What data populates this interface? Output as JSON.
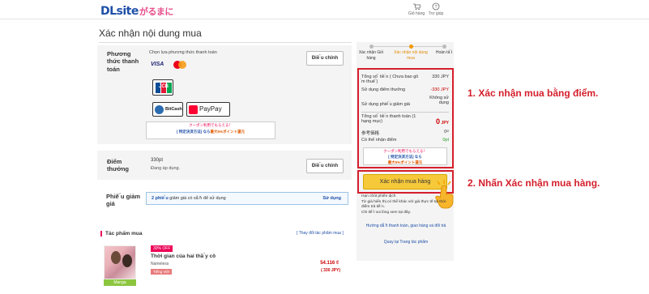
{
  "header": {
    "logo_main": "DLsite",
    "logo_sub": "がるまに",
    "cart_label": "Giỏ hàng",
    "help_label": "Trợ giúp"
  },
  "page_title": "Xác nhận nội dung mua",
  "payment": {
    "label": "Phương thức thanh toán",
    "hint": "Chọn lựa phương thức thanh toán",
    "change_label": "Điề ̀u chỉnh",
    "methods": [
      "VISA",
      "JCB",
      "BitCash",
      "PayPay"
    ],
    "coupon_line1": "クーポン利用でもらえる！",
    "coupon_line2": "[ 特定決済方法] なら",
    "coupon_line3": "最大5%ポイント還元"
  },
  "points": {
    "label": "Điểm thưởng",
    "value": "330pt",
    "status": "Đang áp dụng.",
    "change_label": "Điề ̀u chỉnh"
  },
  "discount": {
    "label": "Phiế ́u giảm giá",
    "text_prefix": "2 phiế ́u",
    "text_rest": " giảm giá có sẵ ̃n để sử dụng",
    "use_label": "Sử dụng"
  },
  "works": {
    "title": "Tác phẩm mua",
    "change_link": "[ Thay đổi tác phẩm mua ]",
    "items": [
      {
        "discount_badge": "30% OFF",
        "title": "Thời gian của hai thầ ̀y cô",
        "circle": "Nameless",
        "tag": "Tiếng Việt",
        "type": "Manga",
        "price": "54.116 ₫",
        "price_jpy": "( 330 JPY)"
      }
    ]
  },
  "steps": [
    {
      "label": "Xác nhận Giỏ hàng",
      "active": false
    },
    {
      "label": "Xác nhận nội dung mua",
      "active": true
    },
    {
      "label": "Hoàn tấ ́t",
      "active": false
    }
  ],
  "summary": {
    "rows": [
      {
        "label": "Tổng số ́ tiề ̀n ( Chưa bao gồ ̀m thuế ́)",
        "value": "330 JPY"
      },
      {
        "label": "Sử dụng điểm thưởng",
        "value": "-330 JPY"
      },
      {
        "label": "Sử dụng phiế ́u giảm giá",
        "value": "Không sử dụng"
      }
    ],
    "total_label": "Tổng số ́ tiề ̀n thanh toán (1 hạng mục)",
    "total_value": "0",
    "total_unit": "JPY",
    "ref_label": "参考価格",
    "ref_value": "0₫",
    "earn_label": "Có thể nhận điểm",
    "earn_value": "0pt",
    "coupon_line1": "クーポン利用でもらえる！",
    "coupon_line2": "[ 特定決済方法] なら",
    "coupon_line3": "最大5%ポイント還元",
    "buy_label": "Xác nhận mua hàng",
    "notes": [
      "Hạn chót phiên dịch",
      "Từ giá hiển thị có thể khác với giá thực tế tại thời điểm trả tiề ̀n.",
      "Chi tiế ́t vui lòng xem tại đây."
    ],
    "guide_link": "Hướng dẫ ̃n thanh toán, giao hàng và đổi trả",
    "rules_link": "Quay lại Trang tác phẩm"
  },
  "callouts": {
    "step1": "1. Xác nhận mua bằng điểm.",
    "step2": "2. Nhấn Xác nhận mua hàng."
  },
  "colors": {
    "accent_red": "#d51f2b",
    "buy_button": "#f6c93b",
    "brand_blue": "#1f4fa8"
  }
}
